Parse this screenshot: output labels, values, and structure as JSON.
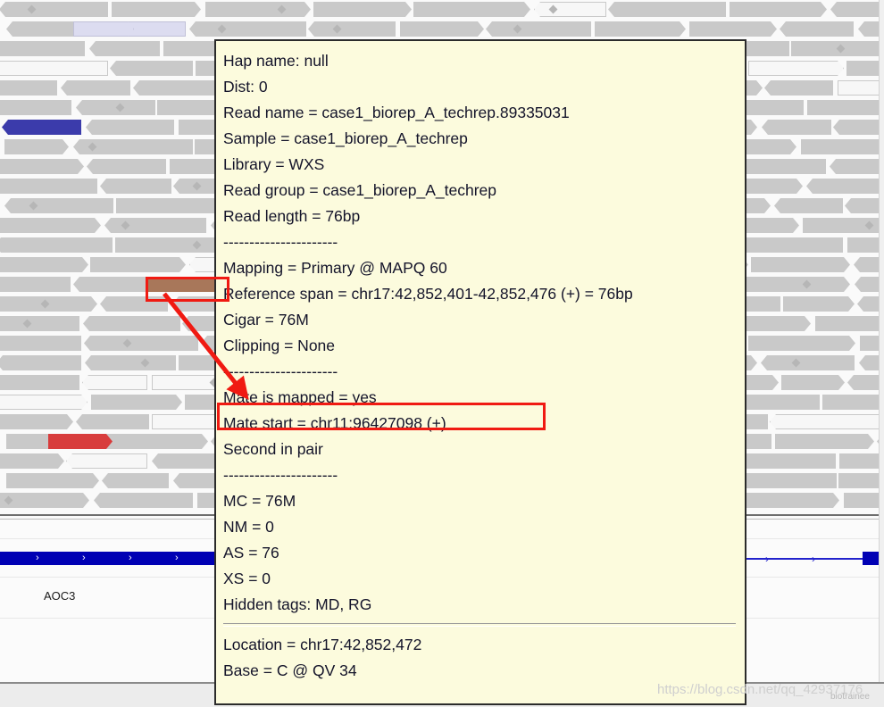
{
  "app": {
    "name": "IGV alignment viewer",
    "view": "read-popup"
  },
  "popup": {
    "title_line": "Hap name: null",
    "lines": [
      {
        "type": "text",
        "text": "Hap name: null"
      },
      {
        "type": "text",
        "text": "Dist: 0"
      },
      {
        "type": "text",
        "text": "Read name = case1_biorep_A_techrep.89335031"
      },
      {
        "type": "text",
        "text": "Sample = case1_biorep_A_techrep"
      },
      {
        "type": "text",
        "text": "Library = WXS"
      },
      {
        "type": "text",
        "text": "Read group = case1_biorep_A_techrep"
      },
      {
        "type": "text",
        "text": "Read length = 76bp"
      },
      {
        "type": "dashes",
        "text": "----------------------"
      },
      {
        "type": "text",
        "text": "Mapping = Primary @ MAPQ 60"
      },
      {
        "type": "text",
        "text": "Reference span = chr17:42,852,401-42,852,476 (+) = 76bp"
      },
      {
        "type": "text",
        "text": "Cigar = 76M"
      },
      {
        "type": "text",
        "text": "Clipping = None"
      },
      {
        "type": "dashes",
        "text": "----------------------"
      },
      {
        "type": "text",
        "text": "Mate is mapped = yes"
      },
      {
        "type": "text",
        "text": "Mate start = chr11:96427098 (+)"
      },
      {
        "type": "text",
        "text": "Second in pair"
      },
      {
        "type": "dashes",
        "text": "----------------------"
      },
      {
        "type": "text",
        "text": "MC = 76M"
      },
      {
        "type": "text",
        "text": "NM = 0"
      },
      {
        "type": "text",
        "text": "AS = 76"
      },
      {
        "type": "text",
        "text": "XS = 0"
      },
      {
        "type": "text",
        "text": "Hidden tags: MD, RG"
      },
      {
        "type": "rule",
        "text": ""
      },
      {
        "type": "text",
        "text": "Location = chr17:42,852,472"
      },
      {
        "type": "text",
        "text": "Base = C @ QV 34"
      }
    ],
    "fields": {
      "hap_name": "Hap name: null",
      "dist": "Dist: 0",
      "read_name": "Read name = case1_biorep_A_techrep.89335031",
      "sample": "Sample = case1_biorep_A_techrep",
      "library": "Library = WXS",
      "read_group": "Read group = case1_biorep_A_techrep",
      "read_length": "Read length = 76bp",
      "mapping": "Mapping = Primary @ MAPQ 60",
      "reference_span": "Reference span = chr17:42,852,401-42,852,476 (+) = 76bp",
      "cigar": "Cigar = 76M",
      "clipping": "Clipping = None",
      "mate_is_mapped": "Mate is mapped = yes",
      "mate_start": "Mate start = chr11:96427098 (+)",
      "pair_order": "Second in pair",
      "mc": "MC = 76M",
      "nm": "NM = 0",
      "as": "AS = 76",
      "xs": "XS = 0",
      "hidden_tags": "Hidden tags: MD, RG",
      "location": "Location = chr17:42,852,472",
      "base": "Base = C @ QV 34"
    },
    "background_color": "#fcfbdd",
    "border_color": "#2b2b2b"
  },
  "annotations": {
    "highlight_color": "#f01a12",
    "read_box_label": "highlighted-read",
    "mate_start_box_label": "mate-start-line",
    "arrow_label": "pointer-from-read-to-mate-start"
  },
  "gene_track": {
    "gene_name": "AOC3",
    "strand_arrow": "›",
    "exon_color": "#0000b4",
    "intron_color": "#2222cc",
    "left_arrows": [
      "›",
      "›",
      "›",
      "›"
    ],
    "right_arrows": [
      "›",
      "›"
    ]
  },
  "alignment_track": {
    "default_read_color": "#c9c9c9",
    "highlighted_read_color": "#a8775a",
    "blue_read_color": "#3b3bab",
    "red_read_color": "#d83c3c",
    "lavender_read_color": "#dcdcf0"
  },
  "watermark": {
    "url": "https://blog.csdn.net/qq_42937176",
    "brand": "biotrainee"
  }
}
